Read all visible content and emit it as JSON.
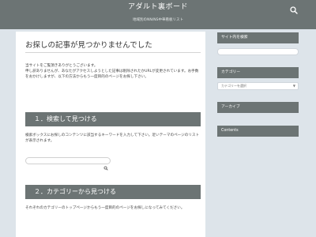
{
  "header": {
    "site_title": "アダルト裏ボード",
    "site_description": "地域別のNN/NS中華看板リスト"
  },
  "main": {
    "title": "お探しの記事が見つかりませんでした",
    "intro_line1": "当サイトをご覧頂きありがとうございます。",
    "intro_line2": "申し訳ありませんが、あなたがアクセスしようとした記事は削除されたかURLが変更されています。お手数をおかけしますが、以下の方法からもう一度目的のページをお探し下さい。",
    "section1_title": "１．検索して見つける",
    "section1_text": "検索ボックスにお探しのコンテンツに該当するキーワードを入力して下さい。近いテーマのページのリストが表示されます。",
    "section2_title": "２．カテゴリーから見つける",
    "section2_text": "それぞれのカテゴリーのトップページからもう一度目的のページをお探しになってみてください。"
  },
  "sidebar": {
    "search_heading": "サイト内を検索",
    "category_heading": "カテゴリー",
    "category_select_value": "カテゴリーを選択",
    "archive_heading": "アーカイブ",
    "contents_heading": "Contents"
  },
  "icons": {
    "header_search": "search-icon",
    "content_search": "search-icon",
    "select_caret": "chevron-down-icon"
  }
}
